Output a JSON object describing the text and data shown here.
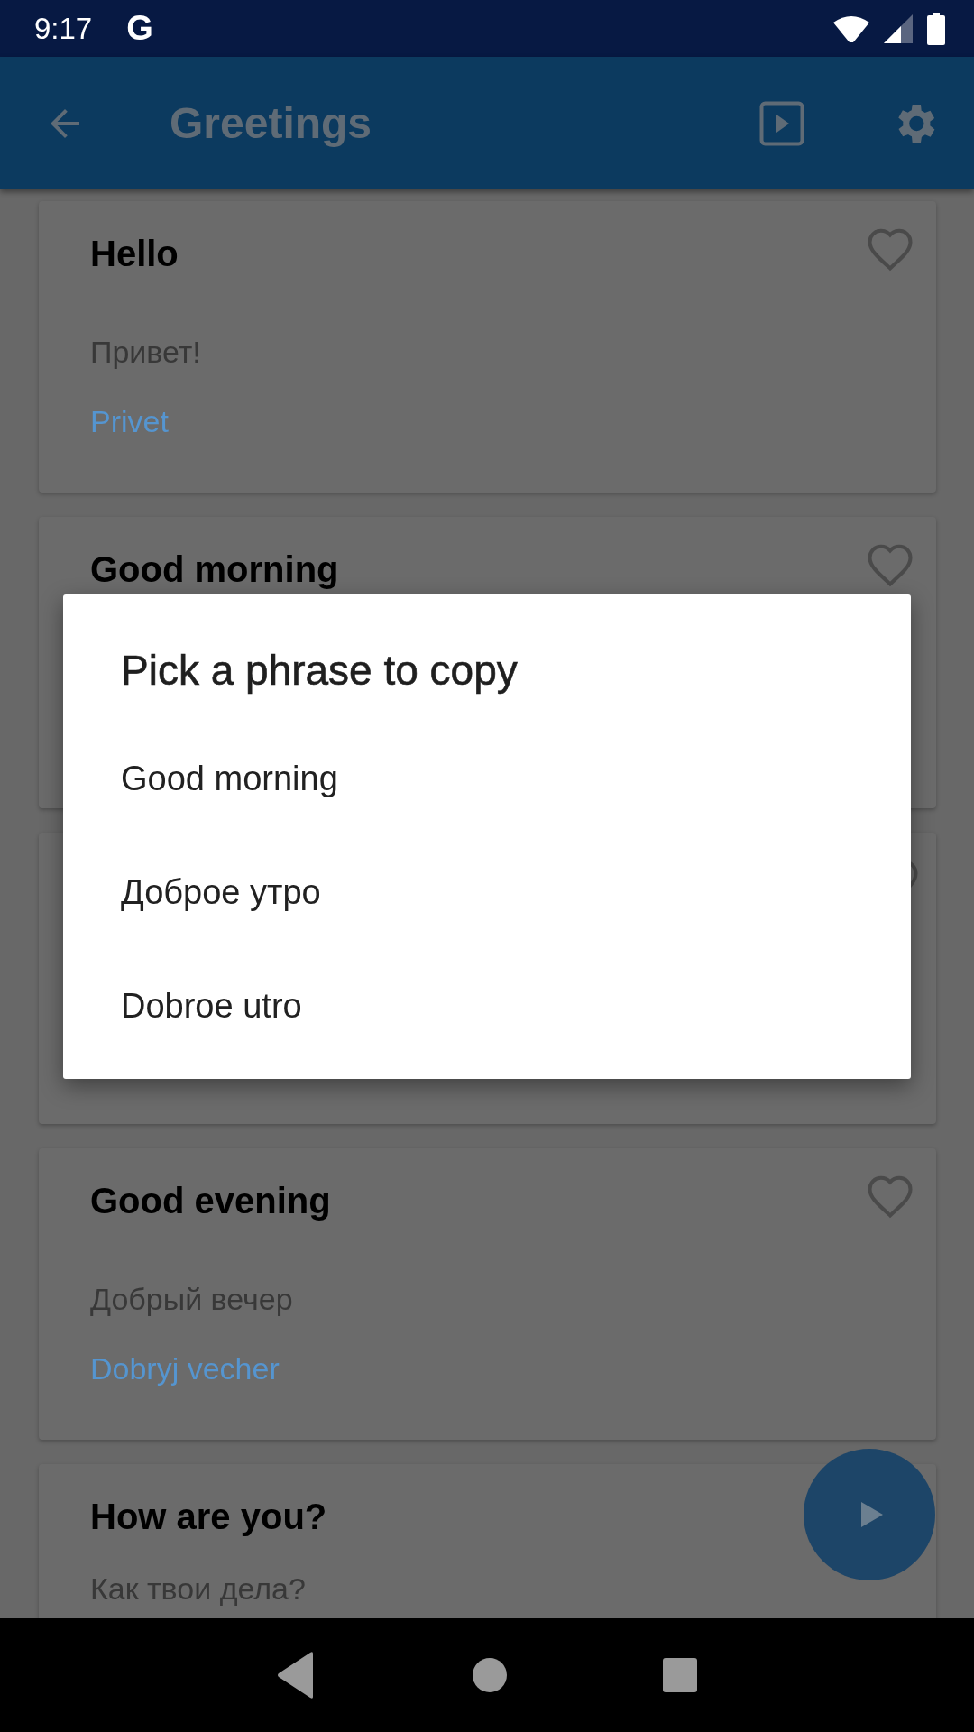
{
  "status_bar": {
    "time": "9:17",
    "app_letter": "G"
  },
  "app_bar": {
    "title": "Greetings"
  },
  "cards": [
    {
      "title": "Hello",
      "native": "Привет!",
      "transliteration": "Privet",
      "favorite": false
    },
    {
      "title": "Good morning",
      "favorite": false
    },
    {
      "favorite": false
    },
    {
      "title": "Good evening",
      "native": "Добрый вечер",
      "transliteration": "Dobryj vecher",
      "favorite": false
    },
    {
      "title": "How are you?",
      "native": "Как твои дела?"
    }
  ],
  "dialog": {
    "title": "Pick a phrase to copy",
    "options": [
      "Good morning",
      "Доброе утро",
      "Dobroe utro"
    ]
  }
}
